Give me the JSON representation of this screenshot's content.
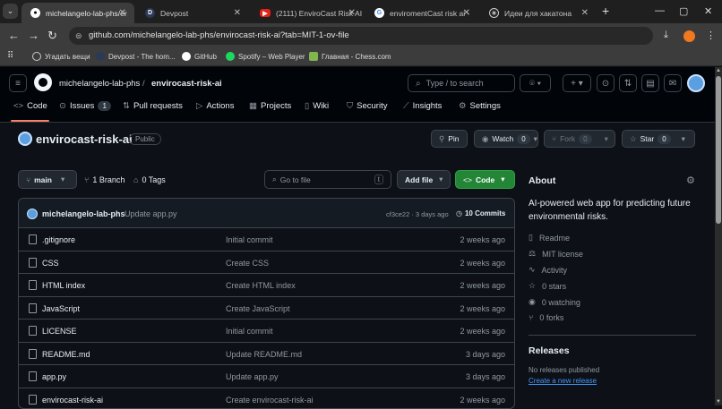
{
  "browser": {
    "tabs": [
      {
        "title": "michelangelo-lab-phs/er",
        "icon": "github-icon",
        "active": true
      },
      {
        "title": "Devpost",
        "icon": "devpost-icon",
        "active": false
      },
      {
        "title": "(2111) EnviroCast Risk AI",
        "icon": "youtube-icon",
        "active": false
      },
      {
        "title": "enviromentCast risk ai -",
        "icon": "google-icon",
        "active": false
      },
      {
        "title": "Идеи для хакатона",
        "icon": "openai-icon",
        "active": false
      }
    ],
    "url": "github.com/michelangelo-lab-phs/envirocast-risk-ai?tab=MIT-1-ov-file",
    "bookmarks": [
      {
        "label": "Угадать вещи"
      },
      {
        "label": "Devpost - The hom..."
      },
      {
        "label": "GitHub"
      },
      {
        "label": "Spotify – Web Player"
      },
      {
        "label": "Главная - Chess.com"
      }
    ]
  },
  "header": {
    "owner": "michelangelo-lab-phs",
    "separator": "/",
    "repo": "envirocast-risk-ai",
    "search_placeholder": "Type / to search",
    "tabs": [
      {
        "label": "Code",
        "icon": "code-icon",
        "count": ""
      },
      {
        "label": "Issues",
        "icon": "issue-icon",
        "count": "1"
      },
      {
        "label": "Pull requests",
        "icon": "pull-request-icon",
        "count": ""
      },
      {
        "label": "Actions",
        "icon": "play-icon",
        "count": ""
      },
      {
        "label": "Projects",
        "icon": "table-icon",
        "count": ""
      },
      {
        "label": "Wiki",
        "icon": "book-icon",
        "count": ""
      },
      {
        "label": "Security",
        "icon": "shield-icon",
        "count": ""
      },
      {
        "label": "Insights",
        "icon": "graph-icon",
        "count": ""
      },
      {
        "label": "Settings",
        "icon": "gear-icon",
        "count": ""
      }
    ]
  },
  "repo": {
    "name": "envirocast-risk-ai",
    "visibility": "Public",
    "pin_label": "Pin",
    "watch_label": "Watch",
    "watch_count": "0",
    "fork_label": "Fork",
    "fork_count": "0",
    "star_label": "Star",
    "star_count": "0"
  },
  "toolbar": {
    "branch": "main",
    "branches": "1 Branch",
    "tags": "0 Tags",
    "goto_placeholder": "Go to file",
    "goto_key": "t",
    "add_file": "Add file",
    "code": "Code"
  },
  "commit": {
    "author": "michelangelo-lab-phs",
    "message": "Update app.py",
    "meta": "cf3ce22 · 3 days ago",
    "commits": "10 Commits"
  },
  "files": [
    {
      "name": ".gitignore",
      "message": "Initial commit",
      "date": "2 weeks ago"
    },
    {
      "name": "CSS",
      "message": "Create CSS",
      "date": "2 weeks ago"
    },
    {
      "name": "HTML index",
      "message": "Create HTML index",
      "date": "2 weeks ago"
    },
    {
      "name": "JavaScript",
      "message": "Create JavaScript",
      "date": "2 weeks ago"
    },
    {
      "name": "LICENSE",
      "message": "Initial commit",
      "date": "2 weeks ago"
    },
    {
      "name": "README.md",
      "message": "Update README.md",
      "date": "3 days ago"
    },
    {
      "name": "app.py",
      "message": "Update app.py",
      "date": "3 days ago"
    },
    {
      "name": "envirocast-risk-ai",
      "message": "Create envirocast-risk-ai",
      "date": "2 weeks ago"
    }
  ],
  "about": {
    "heading": "About",
    "description": "AI-powered web app for predicting future environmental risks.",
    "items": [
      {
        "label": "Readme",
        "icon": "book-icon"
      },
      {
        "label": "MIT license",
        "icon": "law-icon"
      },
      {
        "label": "Activity",
        "icon": "pulse-icon"
      },
      {
        "label": "0 stars",
        "icon": "star-icon"
      },
      {
        "label": "0 watching",
        "icon": "eye-icon"
      },
      {
        "label": "0 forks",
        "icon": "fork-icon"
      }
    ]
  },
  "releases": {
    "heading": "Releases",
    "none": "No releases published",
    "create": "Create a new release"
  },
  "colors": {
    "accent_green": "#238636",
    "link_blue": "#4493f8",
    "bg": "#0d1117"
  }
}
